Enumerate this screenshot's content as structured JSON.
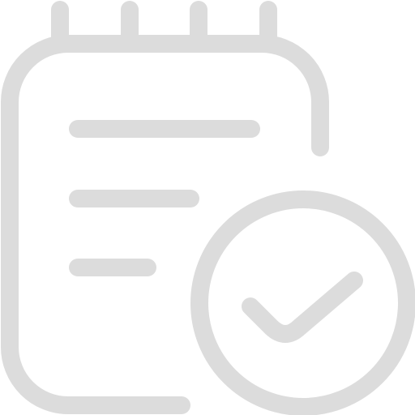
{
  "icon": {
    "name": "notepad-check-icon",
    "stroke_color": "#dcdcdc",
    "background_color": "#ffffff"
  }
}
